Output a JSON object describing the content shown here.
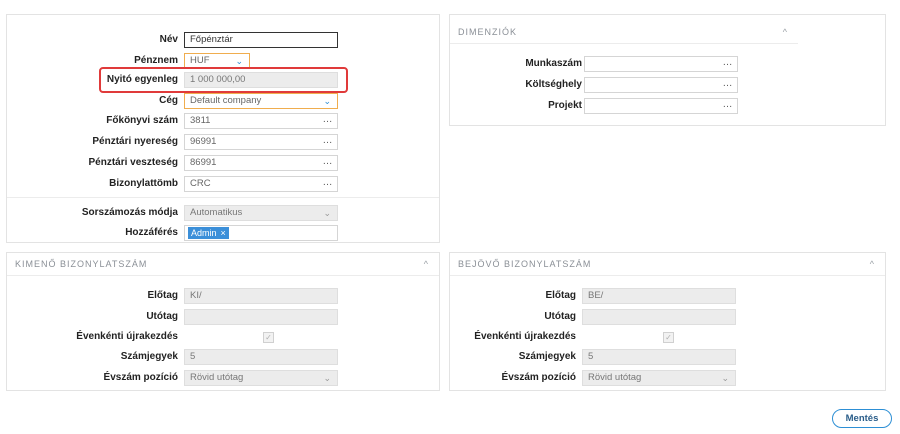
{
  "main": {
    "fields": [
      {
        "label": "Név",
        "value": "Főpénztár"
      },
      {
        "label": "Pénznem",
        "value": "HUF"
      },
      {
        "label": "Nyitó egyenleg",
        "value": "1 000 000,00"
      },
      {
        "label": "Cég",
        "value": "Default company"
      },
      {
        "label": "Főkönyvi szám",
        "value": "3811"
      },
      {
        "label": "Pénztári nyereség",
        "value": "96991"
      },
      {
        "label": "Pénztári veszteség",
        "value": "86991"
      },
      {
        "label": "Bizonylattömb",
        "value": "CRC"
      }
    ],
    "numbering": {
      "label": "Sorszámozás módja",
      "value": "Automatikus"
    },
    "access": {
      "label": "Hozzáférés",
      "tag": "Admin",
      "tag_remove": "×"
    }
  },
  "dimensions": {
    "title": "DIMENZIÓK",
    "fields": [
      {
        "label": "Munkaszám",
        "value": ""
      },
      {
        "label": "Költséghely",
        "value": ""
      },
      {
        "label": "Projekt",
        "value": ""
      }
    ]
  },
  "outgoing": {
    "title": "KIMENŐ BIZONYLATSZÁM",
    "prefix": {
      "label": "Előtag",
      "value": "KI/"
    },
    "suffix": {
      "label": "Utótag",
      "value": ""
    },
    "yearly": {
      "label": "Évenkénti újrakezdés",
      "checked": true
    },
    "digits": {
      "label": "Számjegyek",
      "value": "5"
    },
    "year_pos": {
      "label": "Évszám pozíció",
      "value": "Rövid utótag"
    }
  },
  "incoming": {
    "title": "BEJÖVŐ BIZONYLATSZÁM",
    "prefix": {
      "label": "Előtag",
      "value": "BE/"
    },
    "suffix": {
      "label": "Utótag",
      "value": ""
    },
    "yearly": {
      "label": "Évenkénti újrakezdés",
      "checked": true
    },
    "digits": {
      "label": "Számjegyek",
      "value": "5"
    },
    "year_pos": {
      "label": "Évszám pozíció",
      "value": "Rövid utótag"
    }
  },
  "icons": {
    "dots": "…",
    "chevron_up": "^",
    "chevron_down": "⌄",
    "check": "✓"
  },
  "actions": {
    "save_label": "Mentés"
  },
  "colors": {
    "accent": "#2d8fd5",
    "highlight": "#e03a3a",
    "tag": "#3b8fd9",
    "focus_orange": "#f0ad4e"
  }
}
